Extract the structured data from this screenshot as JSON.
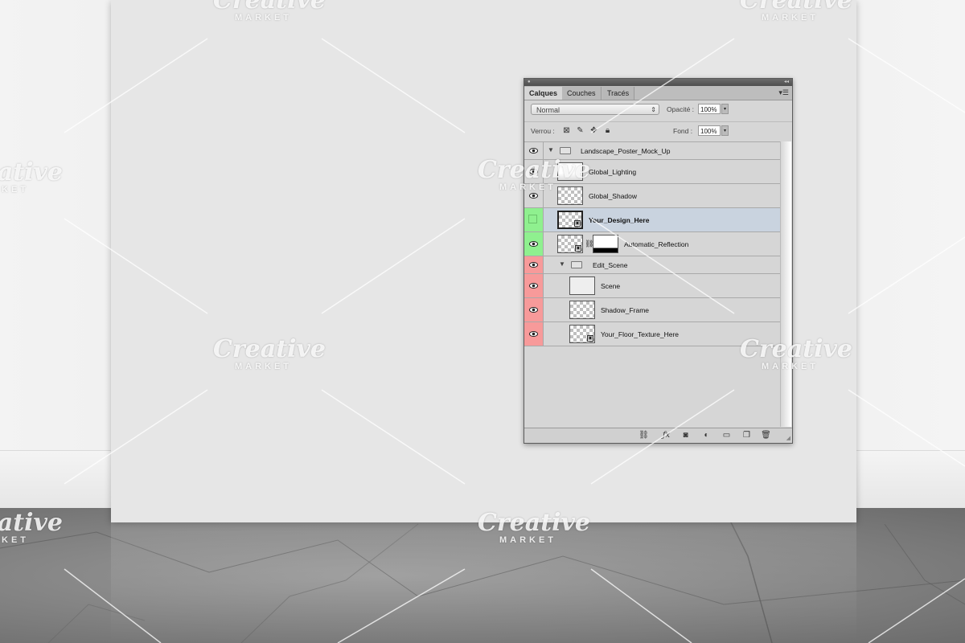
{
  "watermark": {
    "brand": "Creative",
    "sub": "MARKET"
  },
  "panel": {
    "tabs": [
      {
        "label": "Calques",
        "active": true
      },
      {
        "label": "Couches",
        "active": false
      },
      {
        "label": "Tracés",
        "active": false
      }
    ],
    "blend_mode": "Normal",
    "opacity_label": "Opacité :",
    "opacity_value": "100%",
    "lock_label": "Verrou :",
    "fill_label": "Fond :",
    "fill_value": "100%",
    "layers": [
      {
        "name": "Landscape_Poster_Mock_Up",
        "type": "group",
        "eye_color": "none"
      },
      {
        "name": "Global_Lighting",
        "type": "layer",
        "eye_color": "none"
      },
      {
        "name": "Global_Shadow",
        "type": "layer",
        "eye_color": "none"
      },
      {
        "name": "Your_Design_Here",
        "type": "smart-object",
        "eye_color": "green",
        "selected": true,
        "visible": false
      },
      {
        "name": "Automatic_Reflection",
        "type": "masked-layer",
        "eye_color": "green"
      },
      {
        "name": "Edit_Scene",
        "type": "group",
        "eye_color": "red"
      },
      {
        "name": "Scene",
        "type": "layer",
        "eye_color": "red"
      },
      {
        "name": "Shadow_Frame",
        "type": "layer",
        "eye_color": "red"
      },
      {
        "name": "Your_Floor_Texture_Here",
        "type": "smart-object",
        "eye_color": "red"
      }
    ],
    "colors": {
      "green": "#8ff08f",
      "red": "#f79a9a",
      "selected": "#c9d3df"
    }
  }
}
